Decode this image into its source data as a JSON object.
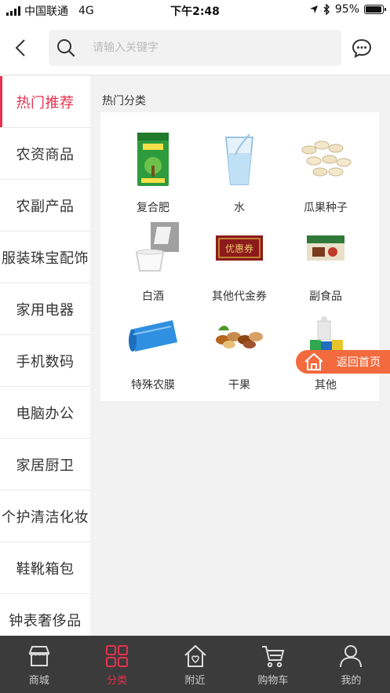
{
  "status_bar": {
    "carrier": "中国联通",
    "network": "4G",
    "time": "下午2:48",
    "battery": "95%",
    "battery_level": 0.95
  },
  "header": {
    "search_placeholder": "请输入关键字"
  },
  "sidebar": {
    "items": [
      {
        "label": "热门推荐",
        "active": true
      },
      {
        "label": "农资商品"
      },
      {
        "label": "农副产品"
      },
      {
        "label": "服装珠宝配饰"
      },
      {
        "label": "家用电器"
      },
      {
        "label": "手机数码"
      },
      {
        "label": "电脑办公"
      },
      {
        "label": "家居厨卫"
      },
      {
        "label": "个护清洁化妆"
      },
      {
        "label": "鞋靴箱包"
      },
      {
        "label": "钟表奢侈品"
      }
    ]
  },
  "main": {
    "section_title": "热门分类",
    "categories": [
      {
        "label": "复合肥",
        "icon": "fertilizer-bag-icon"
      },
      {
        "label": "水",
        "icon": "water-glass-icon"
      },
      {
        "label": "瓜果种子",
        "icon": "seeds-icon"
      },
      {
        "label": "白酒",
        "icon": "liquor-icon"
      },
      {
        "label": "其他代金券",
        "icon": "voucher-icon"
      },
      {
        "label": "副食品",
        "icon": "food-box-icon"
      },
      {
        "label": "特殊农膜",
        "icon": "film-roll-icon"
      },
      {
        "label": "干果",
        "icon": "nuts-icon"
      },
      {
        "label": "其他",
        "icon": "thread-spools-icon"
      }
    ],
    "voucher_text": "优惠券"
  },
  "floating": {
    "return_home": "返回首页"
  },
  "tabbar": {
    "items": [
      {
        "label": "商城",
        "icon": "store-icon"
      },
      {
        "label": "分类",
        "icon": "grid-icon",
        "active": true
      },
      {
        "label": "附近",
        "icon": "nearby-house-icon"
      },
      {
        "label": "购物车",
        "icon": "cart-icon"
      },
      {
        "label": "我的",
        "icon": "user-icon"
      }
    ]
  },
  "colors": {
    "accent": "#e8314e",
    "return_button": "#f26a3d",
    "tabbar_bg": "#3b3b3b"
  }
}
